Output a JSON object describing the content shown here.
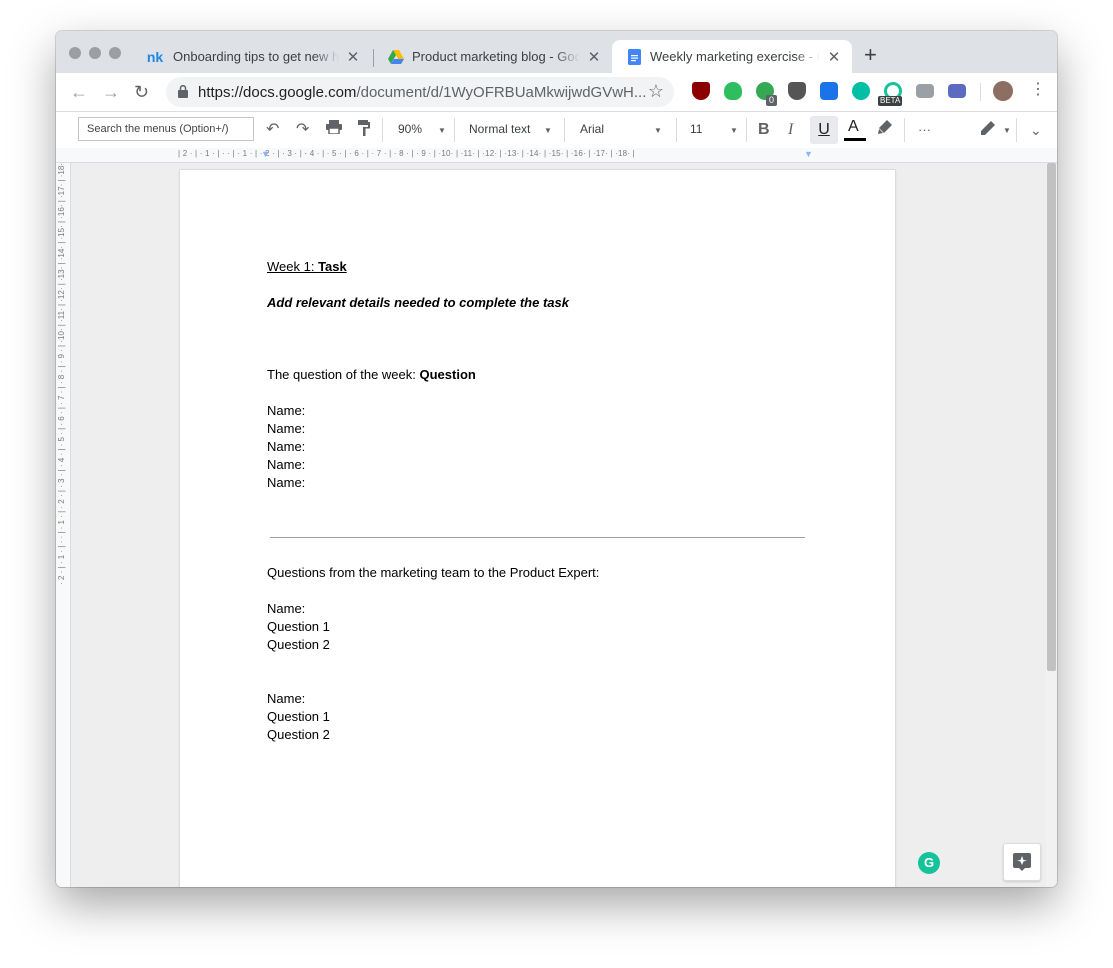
{
  "browser": {
    "tabs": [
      {
        "favicon": "nk",
        "title": "Onboarding tips to get new hires"
      },
      {
        "favicon": "drive-icon",
        "title": "Product marketing blog - Google"
      },
      {
        "favicon": "docs-icon",
        "title": "Weekly marketing exercise - Goo"
      }
    ],
    "new_tab": "+",
    "url_domain": "https://docs.google.com",
    "url_path": "/document/d/1WyOFRBUaMkwijwdGVwH...",
    "extension_badges": {
      "badge_count": "0",
      "beta": "BETA"
    }
  },
  "toolbar": {
    "menu_search_placeholder": "Search the menus (Option+/)",
    "zoom": "90%",
    "style": "Normal text",
    "font": "Arial",
    "size": "11",
    "bold": "B",
    "italic": "I",
    "underline": "U",
    "text_color": "A",
    "more": "···"
  },
  "rulers": {
    "horizontal": "| 2 · | · 1 · | ·   · | · 1 · | · 2 · | · 3 · | · 4 · | · 5 · | · 6 · | · 7 · | · 8 · | · 9 · | ·10· | ·11· | ·12· | ·13· | ·14· | ·15· | ·16· | ·17· | ·18· |",
    "vertical": "· 2 · | · 1 · | ·   · | · 1 · | · 2 · | · 3 · | · 4 · | · 5 · | · 6 · | · 7 · | · 8 · | · 9 · | ·10· | ·11· | ·12· | ·13· | ·14· | ·15· | ·16· | ·17· | ·18·"
  },
  "document": {
    "heading_prefix": "Week 1: ",
    "heading_bold": "Task",
    "subheading": "Add relevant details needed to complete the task",
    "question_prefix": "The question of the week: ",
    "question_bold": "Question",
    "names": [
      "Name:",
      "Name:",
      "Name:",
      "Name:",
      "Name:"
    ],
    "team_questions_label": "Questions from the marketing team to the Product Expert:",
    "block1": [
      "Name:",
      "Question 1",
      "Question 2"
    ],
    "block2": [
      "Name:",
      "Question 1",
      "Question 2"
    ]
  },
  "colors": {
    "docs_blue": "#4285f4",
    "grammarly": "#15c39a"
  }
}
